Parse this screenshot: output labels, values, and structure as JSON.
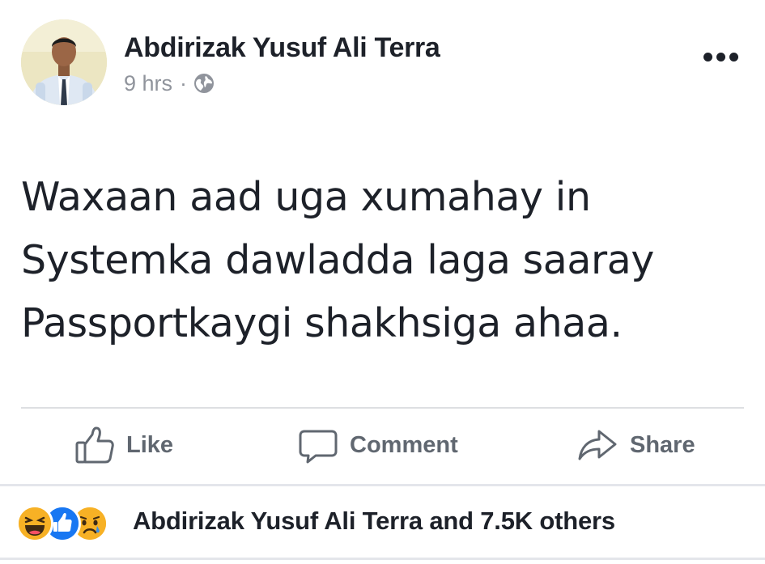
{
  "post": {
    "author": "Abdirizak Yusuf Ali Terra",
    "time": "9 hrs",
    "separator": "·",
    "privacy_icon": "globe-icon",
    "more_icon": "more-options-icon",
    "text_lines": [
      "Waxaan aad uga xumahay in",
      "Systemka dawladda laga saaray",
      "Passportkaygi shakhsiga ahaa."
    ]
  },
  "actions": {
    "like": {
      "label": "Like",
      "icon": "thumbs-up-icon"
    },
    "comment": {
      "label": "Comment",
      "icon": "comment-bubble-icon"
    },
    "share": {
      "label": "Share",
      "icon": "share-arrow-icon"
    }
  },
  "reactions": {
    "icons": [
      "haha-icon",
      "like-reaction-icon",
      "sad-icon"
    ],
    "summary": "Abdirizak Yusuf Ali Terra and 7.5K others"
  },
  "colors": {
    "text": "#1d2129",
    "muted": "#90949c",
    "action": "#606770",
    "like_blue": "#1877f2",
    "emoji_yellow": "#f7b125",
    "divider": "#dddfe2"
  }
}
